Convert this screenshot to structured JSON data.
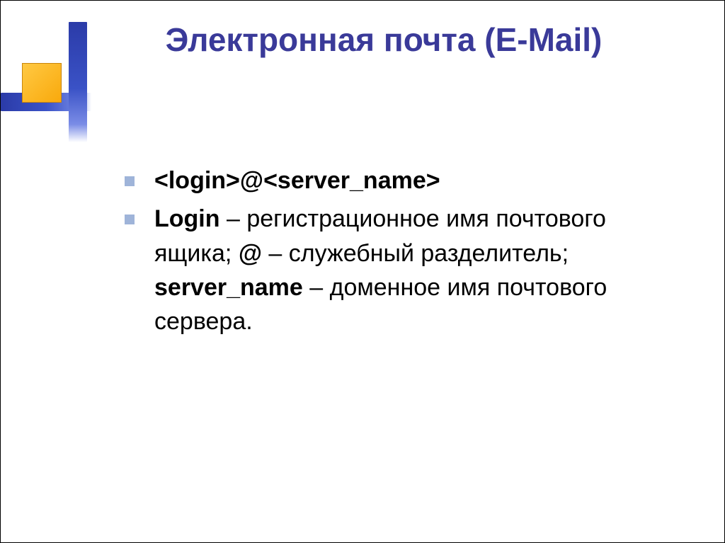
{
  "slide": {
    "title": "Электронная почта (E-Mail)",
    "bullets": [
      {
        "segments": [
          {
            "text": "<login>@<server_name>",
            "bold": true
          }
        ]
      },
      {
        "segments": [
          {
            "text": "Login",
            "bold": true
          },
          {
            "text": " – регистрационное имя почтового ящика; ",
            "bold": false
          },
          {
            "text": "@",
            "bold": true
          },
          {
            "text": " – служебный разделитель; ",
            "bold": false
          },
          {
            "text": "server_name",
            "bold": true
          },
          {
            "text": " – доменное имя почтового сервера.",
            "bold": false
          }
        ]
      }
    ]
  }
}
